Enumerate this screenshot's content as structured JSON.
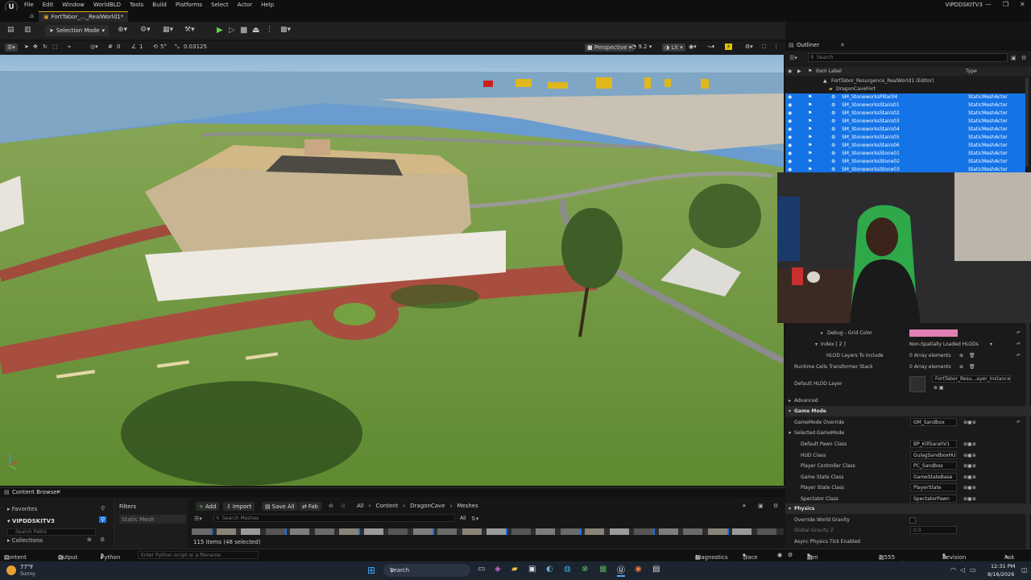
{
  "menubar": {
    "items": [
      "File",
      "Edit",
      "Window",
      "WorldBLD",
      "Tools",
      "Build",
      "Platforms",
      "Select",
      "Actor",
      "Help"
    ],
    "project": "VIPDDSKITV3"
  },
  "tabs": {
    "doc": "FortTabor_..._RealWorld1*"
  },
  "toolbar": {
    "selection_mode": "Selection Mode"
  },
  "viewport_toolbar": {
    "grid_snap": "0",
    "rot_snap": "1",
    "angle": "5°",
    "scale_snap": "0.03125",
    "perspective": "Perspective",
    "speed": "9.2",
    "lit": "Lit"
  },
  "outliner": {
    "title": "Outliner",
    "search_placeholder": "Search",
    "col_label": "Item Label",
    "col_type": "Type",
    "root": "FortTabor_Resurgence_RealWorld1 (Editor)",
    "folder": "DragonCaveFort",
    "rows": [
      {
        "label": "SM_StoneworksPillar04",
        "type": "StaticMeshActor"
      },
      {
        "label": "SM_StoneworksStairs01",
        "type": "StaticMeshActor"
      },
      {
        "label": "SM_StoneworksStairs02",
        "type": "StaticMeshActor"
      },
      {
        "label": "SM_StoneworksStairs03",
        "type": "StaticMeshActor"
      },
      {
        "label": "SM_StoneworksStairs04",
        "type": "StaticMeshActor"
      },
      {
        "label": "SM_StoneworksStairs05",
        "type": "StaticMeshActor"
      },
      {
        "label": "SM_StoneworksStairs06",
        "type": "StaticMeshActor"
      },
      {
        "label": "SM_StoneworksStone01",
        "type": "StaticMeshActor"
      },
      {
        "label": "SM_StoneworksStone02",
        "type": "StaticMeshActor"
      },
      {
        "label": "SM_StoneworksStone03",
        "type": "StaticMeshActor"
      }
    ]
  },
  "details": {
    "debug_grid": "Debug - Grid Color",
    "index": "Index [ 2 ]",
    "index_val": "Non-Spatially Loaded HLODs",
    "hlod_layers": "HLOD Layers To Include",
    "array0": "0 Array elements",
    "runtime_cells": "Runtime Cells Transformer Stack",
    "default_hlod": "Default HLOD Layer",
    "default_hlod_val": "FortTabor_Resu...ayer_Instanced",
    "advanced": "Advanced",
    "game_mode": "Game Mode",
    "gamemode_override": "GameMode Override",
    "gamemode_override_val": "GM_Sandbox",
    "selected_gamemode": "Selected GameMode",
    "props": [
      {
        "k": "Default Pawn Class",
        "v": "BP_KillSarahV1"
      },
      {
        "k": "HUD Class",
        "v": "GulagSandboxHUI"
      },
      {
        "k": "Player Controller Class",
        "v": "PC_Sandbox"
      },
      {
        "k": "Game State Class",
        "v": "GameStateBase"
      },
      {
        "k": "Player State Class",
        "v": "PlayerState"
      },
      {
        "k": "Spectator Class",
        "v": "SpectatorPawn"
      }
    ],
    "physics": "Physics",
    "override_gravity": "Override World Gravity",
    "global_gravity": "Global Gravity Z",
    "global_gravity_val": "0.0",
    "async_physics": "Async Physics Tick Enabled"
  },
  "content_browser": {
    "title": "Content Browser",
    "favorites": "Favorites",
    "project": "VIPDDSKITV3",
    "search_paths": "Search Paths",
    "collections": "Collections",
    "filters": "Filters",
    "static_mesh": "Static Mesh",
    "add": "Add",
    "import": "Import",
    "save_all": "Save All",
    "fab": "Fab",
    "crumbs": [
      "All",
      "Content",
      "DragonCave",
      "Meshes"
    ],
    "search_meshes": "Search Meshes",
    "all": "All",
    "count": "115 items (48 selected)"
  },
  "status": {
    "content_drawer": "Content Drawer",
    "output_log": "Output Log",
    "python": "Python",
    "python_placeholder": "Enter Python script or a filename",
    "diagnostics": "Diagnostics",
    "trace": "Trace",
    "zen": "Zen Server",
    "unsaved": "2,555 Unsaved",
    "revision": "Revision Control",
    "askai": "Ask AI"
  },
  "taskbar": {
    "temp": "77°F",
    "weather": "Sunny",
    "search": "Search",
    "time": "12:31 PM",
    "date": "8/16/2026"
  },
  "colors": {
    "selection": "#1473e6",
    "accent": "#e0a400",
    "grid_color": "#e27fb5"
  }
}
